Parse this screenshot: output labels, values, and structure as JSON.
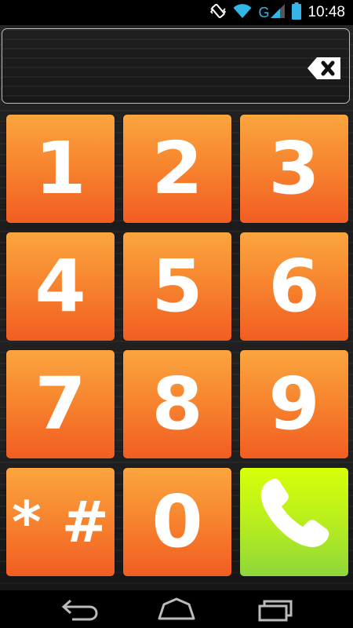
{
  "status_bar": {
    "time": "10:48",
    "network_type": "G",
    "icons": [
      "vibrate-icon",
      "wifi-icon",
      "signal-icon",
      "battery-icon"
    ],
    "battery_color": "#33b5e5"
  },
  "display": {
    "number": "",
    "backspace_icon": "backspace-icon"
  },
  "keypad": {
    "keys": [
      "1",
      "2",
      "3",
      "4",
      "5",
      "6",
      "7",
      "8",
      "9"
    ],
    "star": "*",
    "hash": "#",
    "zero": "0",
    "call_icon": "phone-icon"
  },
  "colors": {
    "key_top": "#fba53f",
    "key_bottom": "#f25d22",
    "call_top": "#d6ff08",
    "call_bottom": "#8fd63a"
  },
  "nav_bar": {
    "icons": [
      "back-icon",
      "home-icon",
      "recents-icon"
    ]
  }
}
